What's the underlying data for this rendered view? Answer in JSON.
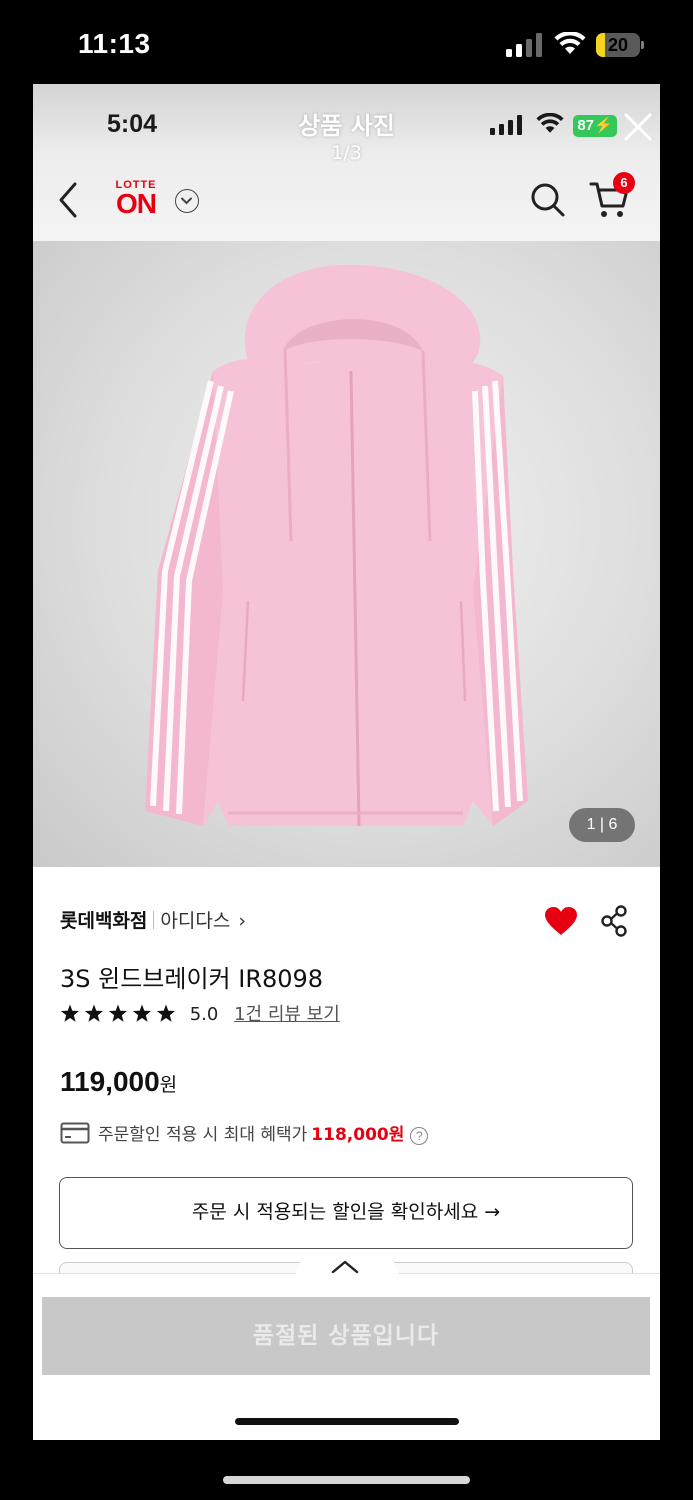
{
  "outer_status": {
    "time": "11:13",
    "battery": "20",
    "battery_level": 0.2
  },
  "inner_status": {
    "time": "5:04",
    "battery": "87"
  },
  "viewer": {
    "title": "상품 사진",
    "count": "1/3"
  },
  "header": {
    "logo_top": "LOTTE",
    "logo_main": "ON",
    "cart_count": "6"
  },
  "product": {
    "image_counter": "1 | 6",
    "store": "롯데백화점",
    "brand": "아디다스",
    "brand_chevron": "›",
    "name": "3S 윈드브레이커 IR8098",
    "rating": "5.0",
    "star_count": 5,
    "review_link": "1건 리뷰 보기",
    "price": "119,000",
    "price_unit": "원",
    "benefit_label": "주문할인 적용 시 최대 혜택가",
    "benefit_price": "118,000원",
    "help": "?",
    "wishlisted": true
  },
  "discount_button": "주문 시 적용되는 할인을 확인하세요 →",
  "soldout_button": "품절된 상품입니다",
  "colors": {
    "brand_red": "#e60012",
    "jacket_pink": "#f6c2d7",
    "soldout_gray": "#c8c8c8",
    "battery_green": "#34c759",
    "battery_yellow": "#f5d321"
  },
  "icons": [
    "back-chevron-icon",
    "search-icon",
    "cart-icon",
    "close-icon",
    "heart-icon",
    "share-icon",
    "card-icon",
    "help-icon",
    "chevron-up-icon",
    "chevron-down-icon",
    "star-icon",
    "signal-icon",
    "wifi-icon",
    "battery-icon"
  ]
}
